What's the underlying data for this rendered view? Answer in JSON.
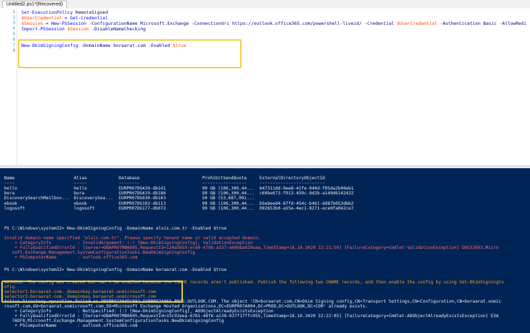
{
  "tab": {
    "title": "Untitled2.ps1*(Recovered)"
  },
  "editor": {
    "line_numbers": [
      "1",
      "2",
      "3",
      "4",
      "5",
      "6",
      "7",
      "8"
    ],
    "lines": [
      [
        {
          "t": "Set-ExecutionPolicy",
          "c": "cmd"
        },
        {
          "t": " RemoteSigned",
          "c": "prm"
        }
      ],
      [
        {
          "t": "$UserCredential",
          "c": "var"
        },
        {
          "t": " = ",
          "c": "prm"
        },
        {
          "t": "Get-Credential",
          "c": "cmd"
        }
      ],
      [
        {
          "t": "$Session",
          "c": "var"
        },
        {
          "t": " = ",
          "c": "prm"
        },
        {
          "t": "New-PSSession",
          "c": "cmd"
        },
        {
          "t": " -ConfigurationName ",
          "c": "prm"
        },
        {
          "t": "Microsoft.Exchange",
          "c": "prm"
        },
        {
          "t": " -ConnectionUri ",
          "c": "prm"
        },
        {
          "t": "https://outlook.office365.com/powershell-liveid/",
          "c": "prm"
        },
        {
          "t": " -Credential ",
          "c": "prm"
        },
        {
          "t": "$UserCredential",
          "c": "var"
        },
        {
          "t": " -Authentication ",
          "c": "prm"
        },
        {
          "t": "Basic",
          "c": "prm"
        },
        {
          "t": " -AllowRedi",
          "c": "prm"
        }
      ],
      [
        {
          "t": "Import-PSSession",
          "c": "cmd"
        },
        {
          "t": " $Session",
          "c": "var"
        },
        {
          "t": " -DisableNameChecking",
          "c": "prm"
        }
      ],
      [],
      [],
      [
        {
          "t": "New-DkimSigningConfig",
          "c": "cmd"
        },
        {
          "t": " -DomainName ",
          "c": "prm"
        },
        {
          "t": "boraarat.com",
          "c": "prm"
        },
        {
          "t": " -Enabled ",
          "c": "prm"
        },
        {
          "t": "$true",
          "c": "var"
        }
      ],
      []
    ]
  },
  "console": {
    "table": {
      "headers": [
        "Name",
        "Alias",
        "Database",
        "ProhibitSendQuota",
        "ExternalDirectoryObjectId"
      ],
      "separators": [
        "----",
        "-----",
        "--------",
        "-----------------",
        "-------------------------"
      ],
      "rows": [
        [
          "hello",
          "hello",
          "EURPR07DG439-db141",
          "99 GB (106,300,44...",
          "647311dd-9ee8-41fe-940d-f05da2b00eb1"
        ],
        [
          "bora",
          "bora",
          "EURPR07DG419-db186",
          "99 GB (106,300,44...",
          "c60be673-f913-459c-8d2b-a149d6142422"
        ],
        [
          "DiscoverySearchMailbox...",
          "DiscoverySea...",
          "EURPR07DG030-db103",
          "50 GB (53,687,091...",
          ""
        ],
        [
          "ebook",
          "ebook",
          "EURPR07DG102-db113",
          "99 GB (106,300,44...",
          "b5ebeed4-87fd-454c-b4b1-dd87b053dbb2"
        ],
        [
          "logosoft",
          "logosoft",
          "EURPR07DG177-db072",
          "99 GB (106,300,44...",
          "092653b0-a55e-4ec1-8271-ece9fa042ce7"
        ]
      ]
    },
    "prompt1": "PS C:\\Windows\\system32> New-DkimSigningConfig -DomainName elsis.com.tr -Enabled $true",
    "error1": [
      "Invalid domain name specified \"elsis.com.tr\". Please specify tenant name or valid accepted domain.",
      "    + CategoryInfo          : InvalidArgument: (:) [New-DkimSigningConfig], ValidationException",
      "    + FullyQualifiedErrorId : [Server=DBAPR07MB6695,RequestId=124a5659-ec60-479b-a337-a60bba929aaa,TimeStamp=18.10.2020 22:21:50] [FailureCategory=Cmdlet-ValidationException] DDC53E63,Micro",
      "   soft.Exchange.Management.SystemConfigurationTasks.NewDkimSigningConfig",
      "    + PSComputerName        : outlook.office365.com"
    ],
    "prompt2": "PS C:\\Windows\\system32> New-DkimSigningConfig -DomainName boraarat.com -Enabled $true",
    "warning": [
      "WARNING: The config was created but can't be enabled because the CNAME records aren't published. Publish the following two CNAME records, and then enable the config by using Set-DkimSigningCo",
      "nfig."
    ],
    "cname": [
      "selector1-boraarat-com._domainkey.boraarat.onmicrosoft.com",
      "selector2-boraarat-com._domainkey.boraarat.onmicrosoft.com"
    ],
    "error2": [
      "Active Directory operation failed on DB8PR07A04DC002.EURPR07A004.PROD.OUTLOOK.COM. The object 'CN=boraarat.com,CN=Dkim Signing config,CN=Transport Settings,CN=Configuration,CN=boraarat.onmic",
      "rosoft.com,OU=boraarat.onmicrosoft.com,OU=Microsoft Exchange Hosted Organizations,DC=EURPR07A004,DC=PROD,DC=OUTLOOK,DC=COM' already exists.",
      "    + CategoryInfo          : NotSpecified: (:) [New-DkimSigningConfig], ADObjectAlreadyExistsException",
      "    + FullyQualifiedErrorId : [Server=DBAPR07MB6695,RequestId=33c92eea-6781-48f6-a138-037f17ffc955,TimeStamp=18.10.2020 22:22:05] [FailureCategory=Cmdlet-ADObjectAlreadyExistsException] E3A",
      "   7ADF8,Microsoft.Exchange.Management.SystemConfigurationTasks.NewDkimSigningConfig",
      "    + PSComputerName        : outlook.office365.com"
    ]
  },
  "colors": {
    "console_bg": "#012456",
    "highlight": "#f1cf3c",
    "error": "#ff6f6f",
    "warning": "#f0a020"
  }
}
